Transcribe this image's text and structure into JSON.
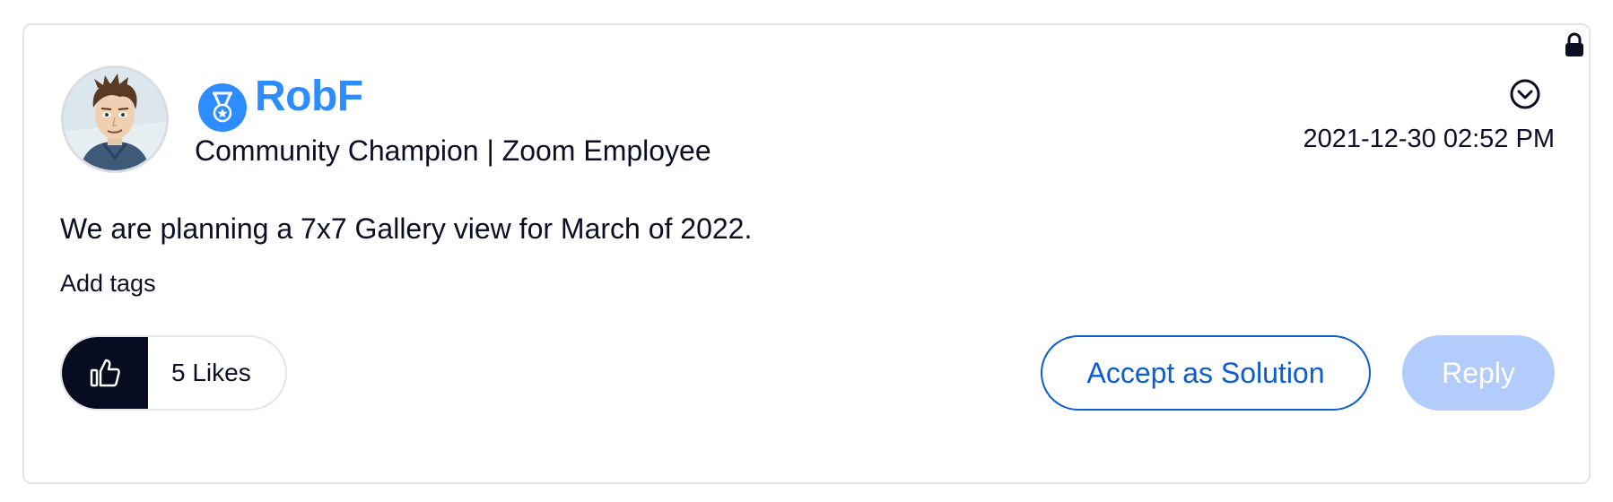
{
  "post": {
    "author": {
      "name": "RobF",
      "rank": "Community Champion | Zoom Employee",
      "avatar_icon": "user-avatar",
      "badge_icon": "medal-icon",
      "name_color": "#2D8CFF"
    },
    "timestamp": "2021-12-30 02:52 PM",
    "body": "We are planning a 7x7 Gallery view for March of 2022.",
    "add_tags_label": "Add tags",
    "locked_icon": "lock-icon",
    "options_icon": "chevron-down-circle-icon"
  },
  "actions": {
    "like_icon": "thumbs-up-icon",
    "likes_label": "5 Likes",
    "accept_label": "Accept as Solution",
    "reply_label": "Reply",
    "accent_color": "#0E5CCF",
    "reply_color": "#B2CDFB"
  }
}
